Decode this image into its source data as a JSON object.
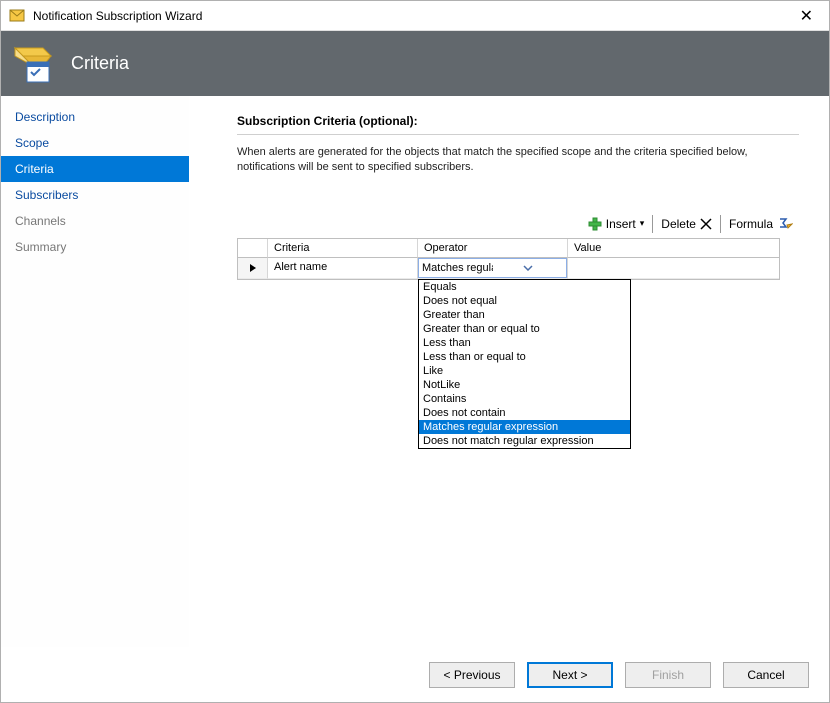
{
  "window": {
    "title": "Notification Subscription Wizard"
  },
  "banner": {
    "title": "Criteria"
  },
  "sidebar": {
    "items": [
      {
        "label": "Description",
        "state": "link"
      },
      {
        "label": "Scope",
        "state": "link"
      },
      {
        "label": "Criteria",
        "state": "selected"
      },
      {
        "label": "Subscribers",
        "state": "link"
      },
      {
        "label": "Channels",
        "state": "muted"
      },
      {
        "label": "Summary",
        "state": "muted"
      }
    ]
  },
  "main": {
    "section_title": "Subscription Criteria (optional):",
    "description": "When alerts are generated for the objects that match the specified scope and the criteria specified below, notifications will be sent to specified subscribers.",
    "toolbar": {
      "insert": "Insert",
      "delete": "Delete",
      "formula": "Formula"
    },
    "table": {
      "headers": {
        "criteria": "Criteria",
        "operator": "Operator",
        "value": "Value"
      },
      "row": {
        "criteria": "Alert name",
        "operator_display": "Matches regular expression",
        "value": ""
      }
    },
    "operator_options": [
      "Equals",
      "Does not equal",
      "Greater than",
      "Greater than or equal to",
      "Less than",
      "Less than or equal to",
      "Like",
      "NotLike",
      "Contains",
      "Does not contain",
      "Matches regular expression",
      "Does not match regular expression"
    ],
    "operator_selected_index": 10
  },
  "footer": {
    "previous": "< Previous",
    "next": "Next >",
    "finish": "Finish",
    "cancel": "Cancel"
  }
}
